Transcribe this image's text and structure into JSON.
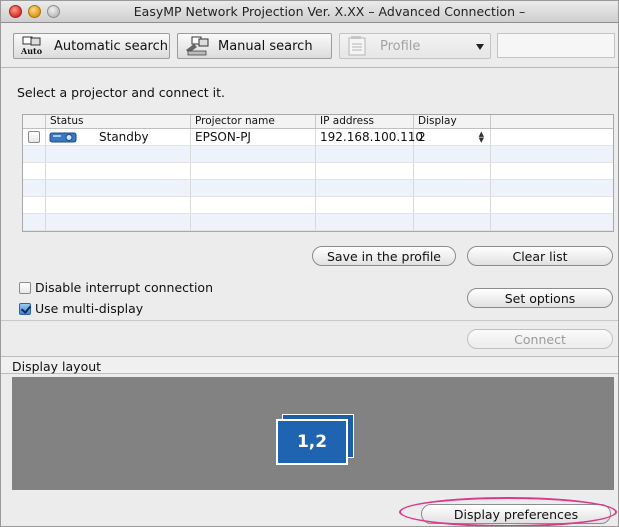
{
  "window": {
    "title": "EasyMP Network Projection Ver. X.XX – Advanced Connection –"
  },
  "toolbar": {
    "automatic_search": {
      "label": "Automatic search",
      "icon": "auto-search-icon"
    },
    "manual_search": {
      "label": "Manual search",
      "icon": "manual-search-icon"
    },
    "profile": {
      "label": "Profile",
      "icon": "profile-icon",
      "enabled": false
    }
  },
  "main": {
    "instruction": "Select a projector and connect it."
  },
  "projector_table": {
    "columns": [
      "Status",
      "Projector name",
      "IP address",
      "Display"
    ],
    "rows": [
      {
        "checked": false,
        "status": "Standby",
        "projector_name": "EPSON-PJ",
        "ip_address": "192.168.100.110",
        "display": "2"
      }
    ]
  },
  "buttons": {
    "save_in_profile": "Save in the profile",
    "clear_list": "Clear list",
    "set_options": "Set options",
    "connect": "Connect",
    "display_preferences": "Display preferences"
  },
  "options": {
    "disable_interrupt": {
      "label": "Disable interrupt connection",
      "checked": false
    },
    "use_multi_display": {
      "label": "Use multi-display",
      "checked": true
    }
  },
  "display_layout": {
    "header": "Display layout",
    "tile_label": "1,2"
  },
  "colors": {
    "display_tile": "#1f64b1",
    "layout_background": "#828282",
    "highlight": "#d93a8a",
    "checkbox_checked": "#3b86d6"
  }
}
